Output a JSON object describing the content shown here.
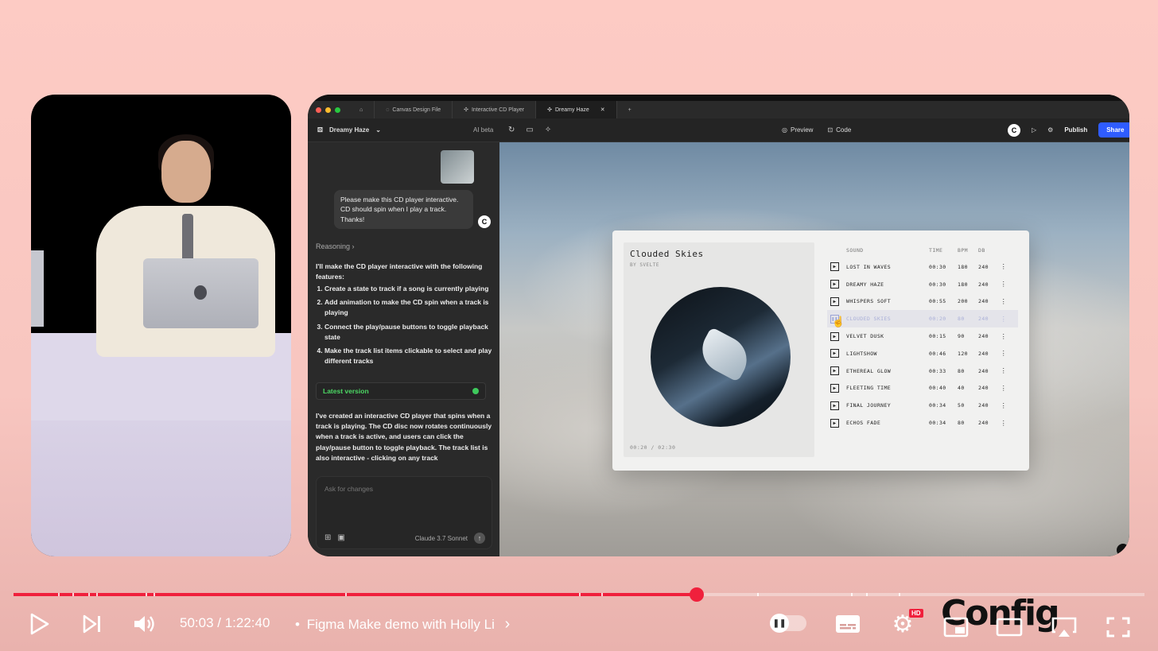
{
  "player": {
    "current_time": "50:03",
    "separator": " / ",
    "duration": "1:22:40",
    "title_sep": "•",
    "video_title": "Figma Make demo with Holly Li",
    "progress_fraction": 0.604,
    "hd_badge": "HD",
    "watermark": "Config"
  },
  "figma": {
    "tabs": [
      {
        "label": "Canvas Design File"
      },
      {
        "label": "Interactive CD Player"
      },
      {
        "label": "Dreamy Haze"
      }
    ],
    "project_name": "Dreamy Haze",
    "ai_label": "AI beta",
    "preview_label": "Preview",
    "code_label": "Code",
    "publish_label": "Publish",
    "share_label": "Share",
    "chat": {
      "user_message": "Please make this CD player interactive. CD should spin when I play a track. Thanks!",
      "reasoning_label": "Reasoning",
      "reply_intro": "I'll make the CD player interactive with the following features:",
      "reply_steps": [
        "Create a state to track if a song is currently playing",
        "Add animation to make the CD spin when a track is playing",
        "Connect the play/pause buttons to toggle playback state",
        "Make the track list items clickable to select and play different tracks"
      ],
      "latest_version_label": "Latest version",
      "reply_summary": "I've created an interactive CD player that spins when a track is playing. The CD disc now rotates continuously when a track is active, and users can click the play/pause button to toggle playback. The track list is also interactive - clicking on any track",
      "composer_placeholder": "Ask for changes",
      "model_label": "Claude 3.7 Sonnet"
    },
    "cd_player": {
      "album_title": "Clouded Skies",
      "artist": "BY SVELTE",
      "time_readout": "00:20 / 02:30",
      "columns": {
        "sound": "SOUND",
        "time": "TIME",
        "bpm": "BPM",
        "db": "DB"
      },
      "tracks": [
        {
          "name": "LOST IN WAVES",
          "time": "00:30",
          "bpm": "180",
          "db": "240",
          "active": false
        },
        {
          "name": "DREAMY HAZE",
          "time": "00:30",
          "bpm": "180",
          "db": "240",
          "active": false
        },
        {
          "name": "WHISPERS SOFT",
          "time": "00:55",
          "bpm": "200",
          "db": "240",
          "active": false
        },
        {
          "name": "CLOUDED SKIES",
          "time": "00:20",
          "bpm": "80",
          "db": "240",
          "active": true
        },
        {
          "name": "VELVET DUSK",
          "time": "00:15",
          "bpm": "90",
          "db": "240",
          "active": false
        },
        {
          "name": "LIGHTSHOW",
          "time": "00:46",
          "bpm": "120",
          "db": "240",
          "active": false
        },
        {
          "name": "ETHEREAL GLOW",
          "time": "00:33",
          "bpm": "80",
          "db": "240",
          "active": false
        },
        {
          "name": "FLEETING TIME",
          "time": "00:40",
          "bpm": "40",
          "db": "240",
          "active": false
        },
        {
          "name": "FINAL JOURNEY",
          "time": "00:34",
          "bpm": "50",
          "db": "240",
          "active": false
        },
        {
          "name": "ECHOS FADE",
          "time": "00:34",
          "bpm": "80",
          "db": "240",
          "active": false
        }
      ]
    }
  },
  "colors": {
    "progress_red": "#f0203c",
    "figma_share_blue": "#2f5cff",
    "latest_green": "#4cd964"
  }
}
